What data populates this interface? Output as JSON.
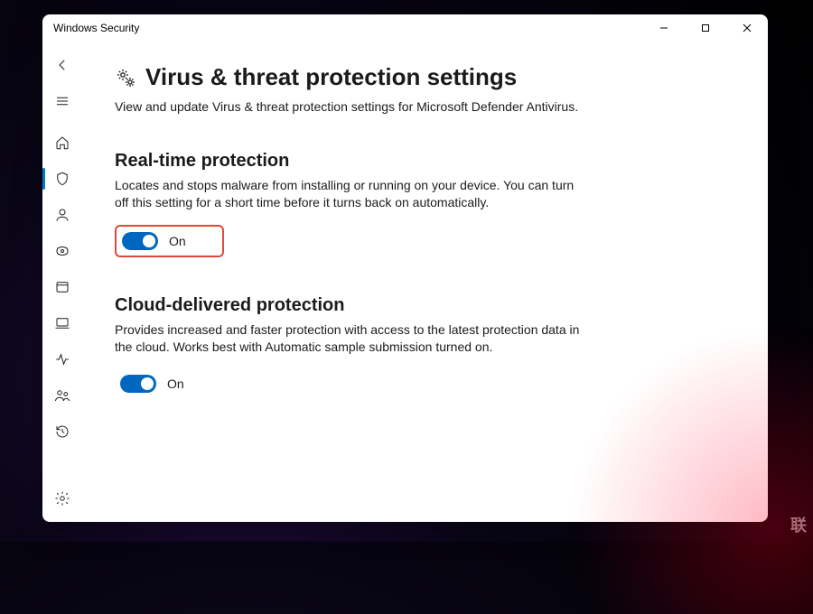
{
  "window": {
    "title": "Windows Security"
  },
  "page": {
    "title": "Virus & threat protection settings",
    "description": "View and update Virus & threat protection settings for Microsoft Defender Antivirus."
  },
  "settings": {
    "realtime": {
      "title": "Real-time protection",
      "description": "Locates and stops malware from installing or running on your device. You can turn off this setting for a short time before it turns back on automatically.",
      "state_label": "On"
    },
    "cloud": {
      "title": "Cloud-delivered protection",
      "description": "Provides increased and faster protection with access to the latest protection data in the cloud. Works best with Automatic sample submission turned on.",
      "state_label": "On"
    }
  },
  "watermark": "联"
}
